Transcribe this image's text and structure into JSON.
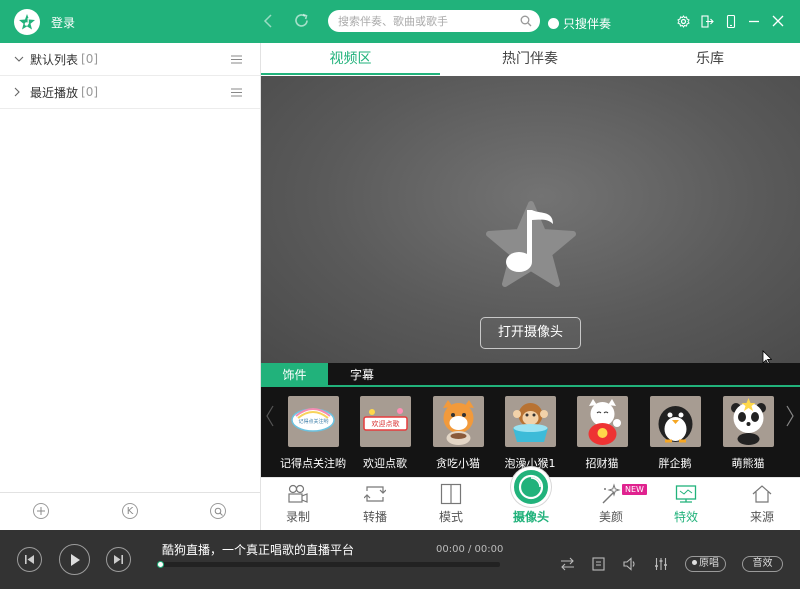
{
  "app": {
    "login_label": "登录",
    "accent": "#21b27b"
  },
  "search": {
    "placeholder": "搜索伴奏、歌曲或歌手",
    "value": ""
  },
  "only_accompaniment_label": "只搜伴奏",
  "playlists": [
    {
      "name": "默认列表",
      "count": "[0]"
    },
    {
      "name": "最近播放",
      "count": "[0]"
    }
  ],
  "left_bottom_icons": [
    "add-icon",
    "k-song-icon",
    "search-song-icon"
  ],
  "left_bottom_k_letter": "K",
  "tabs": [
    "视频区",
    "热门伴奏",
    "乐库"
  ],
  "active_tab": "视频区",
  "video": {
    "open_camera_label": "打开摄像头"
  },
  "decorations": {
    "subtabs": [
      "饰件",
      "字幕"
    ],
    "items": [
      {
        "label": "记得点关注哟",
        "sticker_text": "记得点关注哟"
      },
      {
        "label": "欢迎点歌",
        "sticker_text": "欢迎点歌"
      },
      {
        "label": "贪吃小猫",
        "sticker_text": ""
      },
      {
        "label": "泡澡小猴1",
        "sticker_text": ""
      },
      {
        "label": "招财猫",
        "sticker_text": ""
      },
      {
        "label": "胖企鹅",
        "sticker_text": ""
      },
      {
        "label": "萌熊猫",
        "sticker_text": ""
      }
    ]
  },
  "toolbar": {
    "items": [
      "录制",
      "转播",
      "模式",
      "摄像头",
      "美颜",
      "特效",
      "来源"
    ],
    "new_badge": "NEW"
  },
  "player": {
    "marquee": "酷狗直播，一个真正唱歌的直播平台",
    "time": "00:00 / 00:00",
    "progress": 0,
    "original_label": "原唱",
    "effect_label": "音效"
  }
}
